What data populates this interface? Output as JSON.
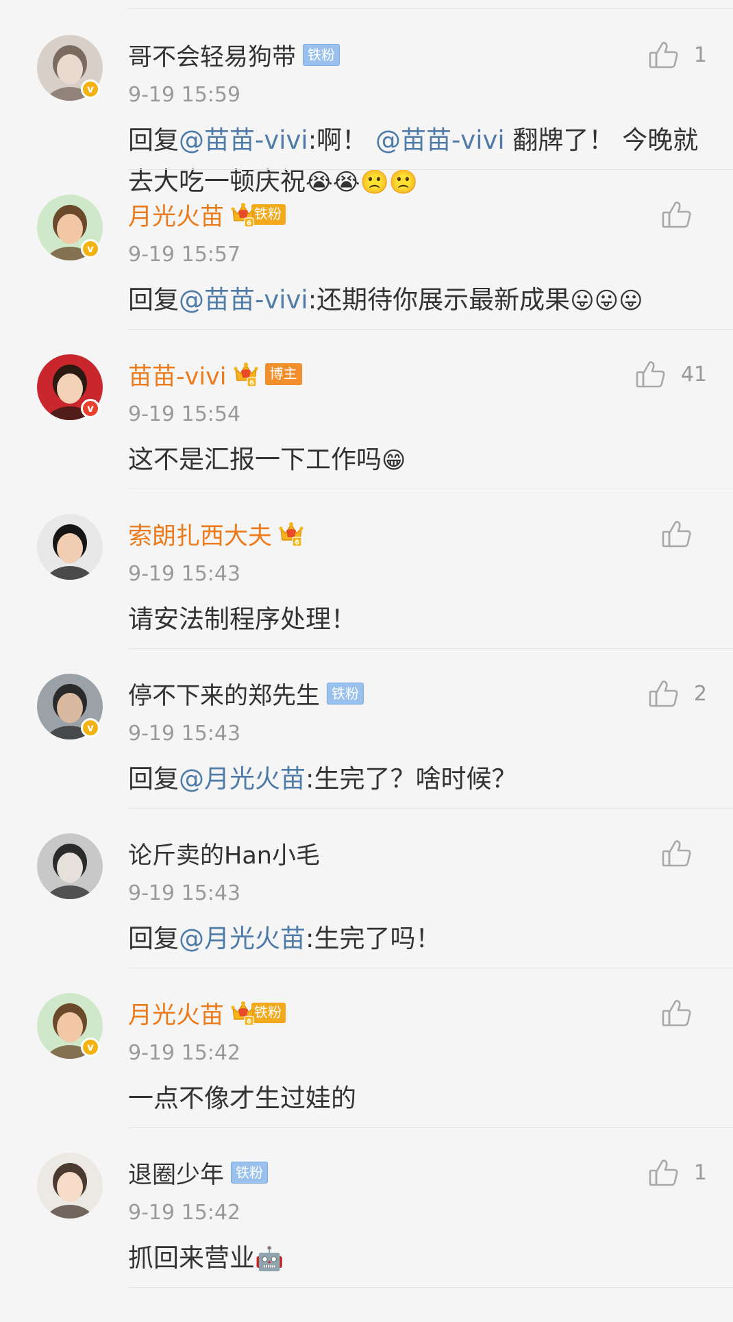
{
  "comments": [
    {
      "id": "c1",
      "name": "哥不会轻易狗带",
      "name_color": "#333333",
      "crown": false,
      "badge": "铁粉",
      "badge_style": "blue",
      "verify": "gold",
      "time": "9-19 15:59",
      "likes": "1",
      "parts": [
        {
          "t": "回复"
        },
        {
          "t": "@苗苗-vivi",
          "m": true
        },
        {
          "t": ":啊！ "
        },
        {
          "t": "@苗苗-vivi",
          "m": true
        },
        {
          "t": " 翻牌了！ 今晚就去大吃一顿庆祝"
        },
        {
          "t": "😭😭🙁🙁",
          "e": true
        }
      ]
    },
    {
      "id": "c2",
      "name": "月光火苗",
      "name_color": "#ED7B1B",
      "crown": true,
      "badge": "铁粉",
      "badge_style": "gold",
      "verify": "gold",
      "time": "9-19 15:57",
      "likes": "",
      "parts": [
        {
          "t": "回复"
        },
        {
          "t": "@苗苗-vivi",
          "m": true
        },
        {
          "t": ":还期待你展示最新成果"
        },
        {
          "t": "😛😛😛",
          "e": true
        }
      ]
    },
    {
      "id": "c3",
      "name": "苗苗-vivi",
      "name_color": "#ED7B1B",
      "crown": true,
      "badge": "博主",
      "badge_style": "orange",
      "verify": "red",
      "time": "9-19 15:54",
      "likes": "41",
      "parts": [
        {
          "t": "这不是汇报一下工作吗"
        },
        {
          "t": "😁",
          "e": true
        }
      ]
    },
    {
      "id": "c4",
      "name": "索朗扎西大夫",
      "name_color": "#ED7B1B",
      "crown": true,
      "badge": "",
      "badge_style": "none",
      "verify": "none",
      "time": "9-19 15:43",
      "likes": "",
      "parts": [
        {
          "t": "请安法制程序处理！"
        }
      ]
    },
    {
      "id": "c5",
      "name": "停不下来的郑先生",
      "name_color": "#333333",
      "crown": false,
      "badge": "铁粉",
      "badge_style": "blue",
      "verify": "gold",
      "time": "9-19 15:43",
      "likes": "2",
      "parts": [
        {
          "t": "回复"
        },
        {
          "t": "@月光火苗",
          "m": true
        },
        {
          "t": ":生完了？啥时候？"
        }
      ]
    },
    {
      "id": "c6",
      "name": "论斤卖的Han小毛",
      "name_color": "#333333",
      "crown": false,
      "badge": "",
      "badge_style": "none",
      "verify": "none",
      "time": "9-19 15:43",
      "likes": "",
      "parts": [
        {
          "t": "回复"
        },
        {
          "t": "@月光火苗",
          "m": true
        },
        {
          "t": ":生完了吗！"
        }
      ]
    },
    {
      "id": "c7",
      "name": "月光火苗",
      "name_color": "#ED7B1B",
      "crown": true,
      "badge": "铁粉",
      "badge_style": "gold",
      "verify": "gold",
      "time": "9-19 15:42",
      "likes": "",
      "parts": [
        {
          "t": "一点不像才生过娃的"
        }
      ]
    },
    {
      "id": "c8",
      "name": "退圈少年",
      "name_color": "#333333",
      "crown": false,
      "badge": "铁粉",
      "badge_style": "blue",
      "verify": "none",
      "time": "9-19 15:42",
      "likes": "1",
      "parts": [
        {
          "t": "抓回来营业"
        },
        {
          "t": "🤖",
          "e": true
        }
      ]
    }
  ],
  "icons": {
    "like": "thumbs-up-icon",
    "crown": "crown-level-icon",
    "verify": "verified-v-icon"
  },
  "colors": {
    "mention": "#4F7BA8",
    "orange_name": "#ED7B1B",
    "time": "#9A9A9A",
    "like": "#999999"
  }
}
